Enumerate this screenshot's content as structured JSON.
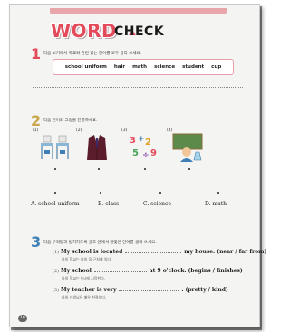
{
  "header": {
    "title_word": "WORD",
    "title_check": "CHECK",
    "accent_color": "#e34b5b"
  },
  "section1": {
    "number": "1",
    "instruction": "다음 보기에서 학교와 관련 있는 단어를 모두 골라 쓰세요.",
    "words": [
      "school uniform",
      "hair",
      "math",
      "science",
      "student",
      "cup"
    ]
  },
  "section2": {
    "number": "2",
    "instruction": "다음 단어와 그림을 연결하세요.",
    "picture_labels": [
      "(1)",
      "(2)",
      "(3)",
      "(4)"
    ],
    "pictures": [
      "classroom-desks-icon",
      "school-uniform-icon",
      "math-numbers-icon",
      "science-lab-icon"
    ],
    "options": [
      "A. school uniform",
      "B. class",
      "C. science",
      "D. math"
    ]
  },
  "section3": {
    "number": "3",
    "instruction": "다음 우리말과 일치하도록 괄호 안에서 알맞은 단어를 골라 쓰세요.",
    "items": [
      {
        "num": "(1)",
        "before": "My school is located",
        "after": "my house. (near / far from)",
        "korean": "나의 학교는 나의 집 근처에 있다."
      },
      {
        "num": "(2)",
        "before": "My school",
        "after": "at 9 o'clock. (begins / finishes)",
        "korean": "나의 학교는 9시에 시작한다."
      },
      {
        "num": "(3)",
        "before": "My teacher is very",
        "after": ". (pretty / kind)",
        "korean": "나의 선생님은 매우 친절하다."
      }
    ]
  },
  "footer": {
    "page_number": "16"
  }
}
